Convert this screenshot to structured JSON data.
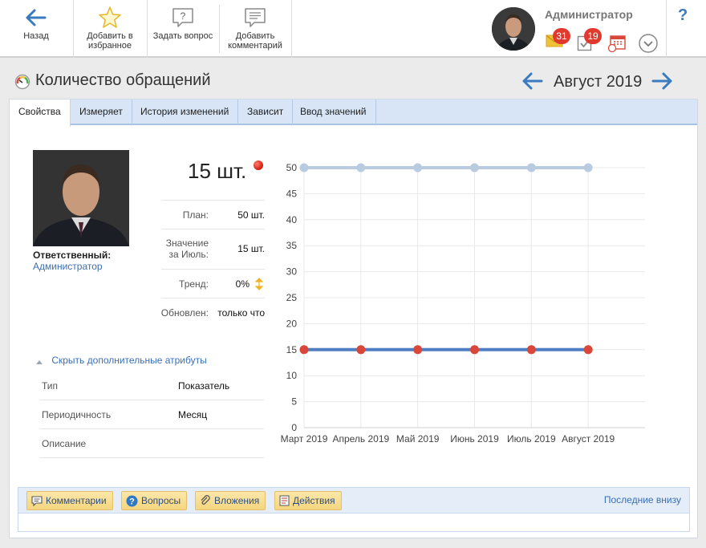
{
  "toolbar": {
    "back": "Назад",
    "favorite": "Добавить в избранное",
    "ask": "Задать вопрос",
    "comment": "Добавить комментарий"
  },
  "user": {
    "name": "Администратор",
    "mail_count": "31",
    "tasks_count": "19"
  },
  "help": "?",
  "page": {
    "title": "Количество обращений",
    "period": "Август 2019"
  },
  "tabs": [
    "Свойства",
    "Измеряет",
    "История изменений",
    "Зависит",
    "Ввод значений"
  ],
  "responsible": {
    "label": "Ответственный:",
    "name": "Администратор"
  },
  "indicator": {
    "value": "15 шт.",
    "plan_label": "План:",
    "plan_value": "50 шт.",
    "month_label_1": "Значение",
    "month_label_2": "за Июль:",
    "month_value": "15 шт.",
    "trend_label": "Тренд:",
    "trend_value": "0%",
    "updated_label": "Обновлен:",
    "updated_value": "только что"
  },
  "attributes": {
    "toggle": "Скрыть дополнительные атрибуты",
    "rows": [
      {
        "k": "Тип",
        "v": "Показатель"
      },
      {
        "k": "Периодичность",
        "v": "Месяц"
      },
      {
        "k": "Описание",
        "v": ""
      }
    ]
  },
  "chart_data": {
    "type": "line",
    "categories": [
      "Март 2019",
      "Апрель 2019",
      "Май 2019",
      "Июнь 2019",
      "Июль 2019",
      "Август 2019"
    ],
    "series": [
      {
        "values": [
          50,
          50,
          50,
          50,
          50,
          50
        ],
        "color": "#b9cbe0",
        "marker": "#b9cbe0"
      },
      {
        "values": [
          15,
          15,
          15,
          15,
          15,
          15
        ],
        "color": "#4f7fc1",
        "marker": "#d9463a"
      }
    ],
    "yticks": [
      0,
      5,
      10,
      15,
      20,
      25,
      30,
      35,
      40,
      45,
      50
    ],
    "ylim": [
      0,
      50
    ],
    "grid": true
  },
  "bottom": {
    "comments": "Комментарии",
    "questions": "Вопросы",
    "attachments": "Вложения",
    "actions": "Действия",
    "last_bottom": "Последние внизу"
  },
  "colors": {
    "accent": "#3a7bbf",
    "badge": "#e03a2f",
    "tab_bar": "#d7e5f7"
  }
}
